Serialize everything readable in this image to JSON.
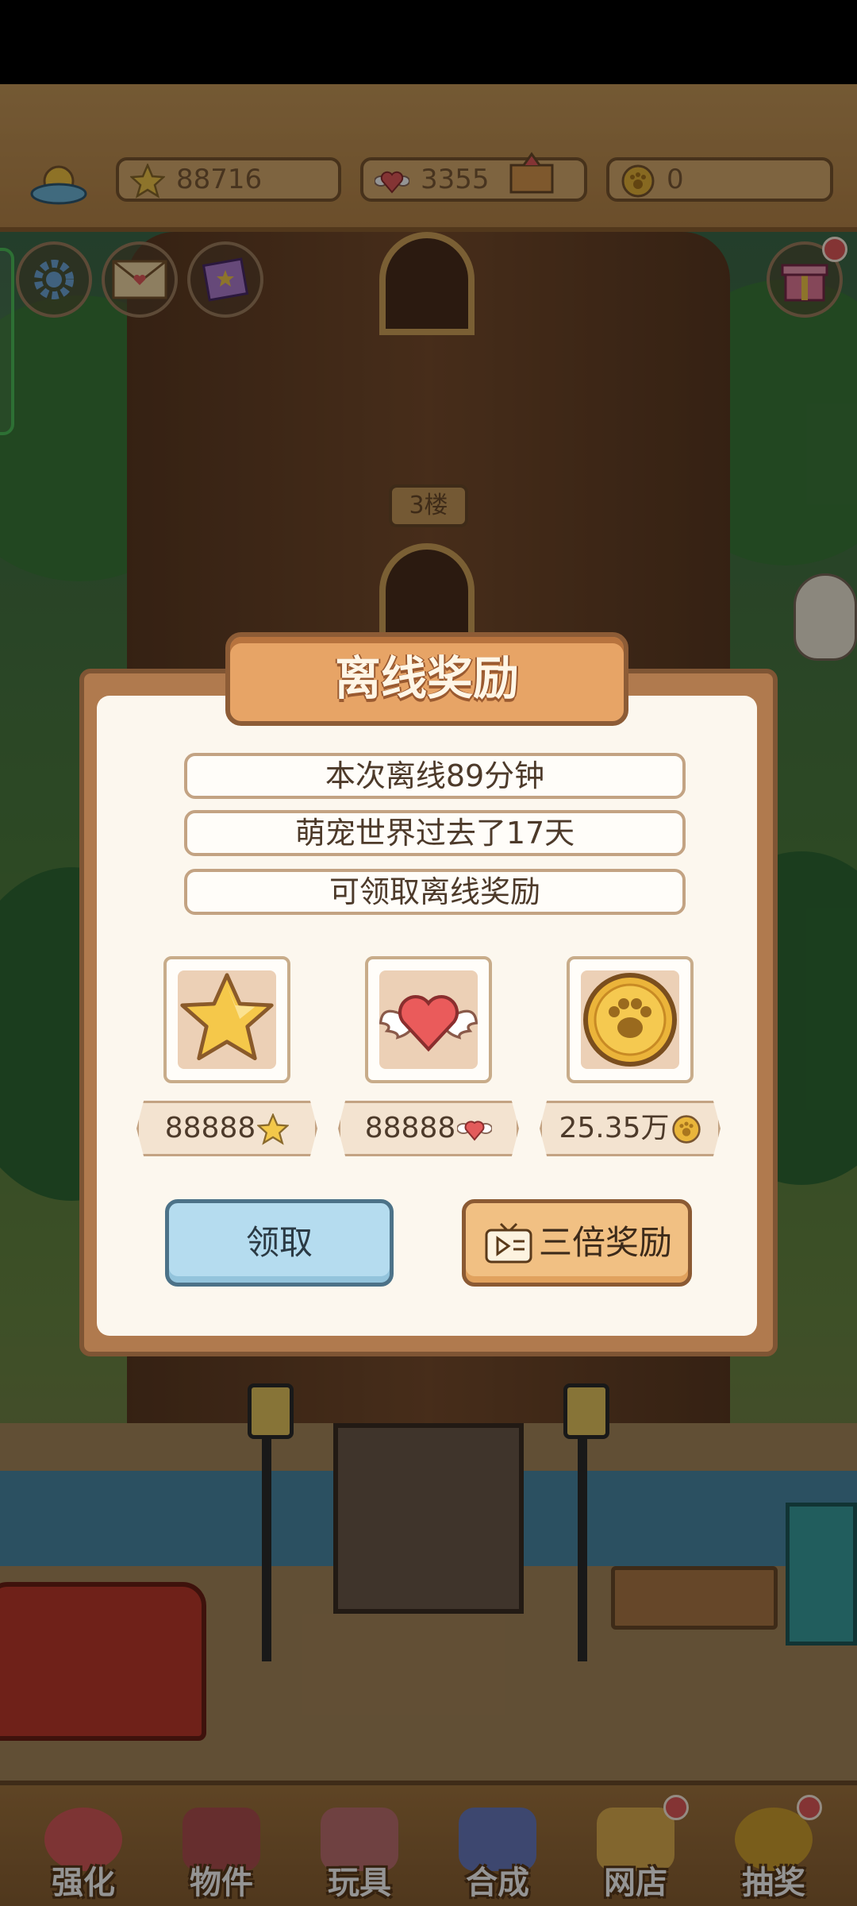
{
  "hud": {
    "stars": "88716",
    "hearts": "3355",
    "coins": "0"
  },
  "scene": {
    "floor_label": "3楼"
  },
  "dialog": {
    "title": "离线奖励",
    "lines": [
      "本次离线89分钟",
      "萌宠世界过去了17天",
      "可领取离线奖励"
    ],
    "rewards": [
      {
        "icon": "star-icon",
        "amount": "88888"
      },
      {
        "icon": "winged-heart-icon",
        "amount": "88888"
      },
      {
        "icon": "paw-coin-icon",
        "amount": "25.35万"
      }
    ],
    "claim_label": "领取",
    "triple_label": "三倍奖励"
  },
  "nav": {
    "items": [
      {
        "label": "强化",
        "color": "#d85a5a"
      },
      {
        "label": "物件",
        "color": "#b05050"
      },
      {
        "label": "玩具",
        "color": "#c07070"
      },
      {
        "label": "合成",
        "color": "#6a7ac0"
      },
      {
        "label": "网店",
        "color": "#e0b050"
      },
      {
        "label": "抽奖",
        "color": "#d0a030"
      }
    ]
  },
  "colors": {
    "dialog_frame": "#b07a4e",
    "dialog_bg": "#fcf7ee",
    "title_bar": "#e7a466",
    "claim_button": "#b5dcef",
    "triple_button": "#f1c083"
  }
}
